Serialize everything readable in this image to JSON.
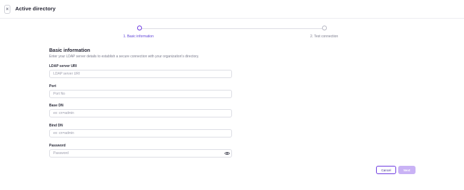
{
  "header": {
    "close_icon": "close-icon",
    "title": "Active directory"
  },
  "stepper": {
    "steps": [
      {
        "label": "1. Basic information",
        "state": "active"
      },
      {
        "label": "2. Test connection",
        "state": "inactive"
      }
    ],
    "accent_color": "#6a36e0"
  },
  "form": {
    "title": "Basic information",
    "description": "Enter your LDAP server details to establish a secure connection with your organization's directory.",
    "fields": [
      {
        "label": "LDAP server URI",
        "value": "",
        "placeholder": "LDAP server URI"
      },
      {
        "label": "Port",
        "value": "",
        "placeholder": "Port No"
      },
      {
        "label": "Base DN",
        "value": "",
        "placeholder": "ex: cn=admin"
      },
      {
        "label": "Bind DN",
        "value": "",
        "placeholder": "ex: cn=admin"
      },
      {
        "label": "Password",
        "value": "",
        "placeholder": "Password",
        "icon": "eye-icon"
      }
    ]
  },
  "footer": {
    "cancel_label": "Cancel",
    "next_label": "Next",
    "next_color": "#c9b2f5"
  }
}
